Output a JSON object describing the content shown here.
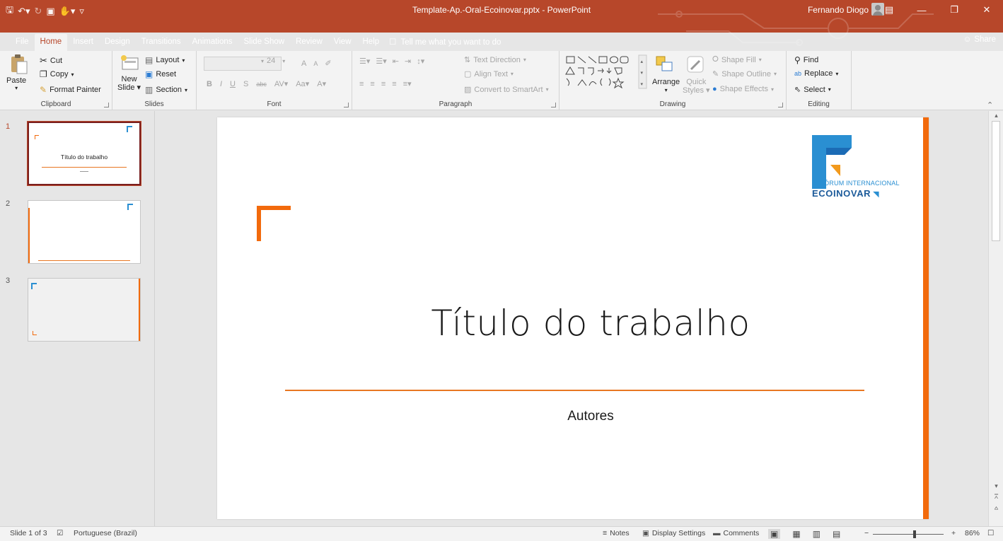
{
  "titlebar": {
    "doc_title": "Template-Ap.-Oral-Ecoinovar.pptx  -  PowerPoint",
    "user": "Fernando Diogo"
  },
  "tabs": {
    "file": "File",
    "home": "Home",
    "insert": "Insert",
    "design": "Design",
    "transitions": "Transitions",
    "animations": "Animations",
    "slideshow": "Slide Show",
    "review": "Review",
    "view": "View",
    "help": "Help",
    "tell": "Tell me what you want to do",
    "share": "Share"
  },
  "ribbon": {
    "clipboard": {
      "paste": "Paste",
      "cut": "Cut",
      "copy": "Copy",
      "format_painter": "Format Painter",
      "label": "Clipboard"
    },
    "slides": {
      "new_slide_1": "New",
      "new_slide_2": "Slide",
      "layout": "Layout",
      "reset": "Reset",
      "section": "Section",
      "label": "Slides"
    },
    "font": {
      "size": "24",
      "bold": "B",
      "italic": "I",
      "underline": "U",
      "shadow": "S",
      "strike": "abc",
      "spacing": "AV",
      "case": "Aa",
      "color": "A",
      "grow": "A",
      "shrink": "A",
      "label": "Font"
    },
    "paragraph": {
      "text_direction": "Text Direction",
      "align_text": "Align Text",
      "convert_smartart": "Convert to SmartArt",
      "label": "Paragraph"
    },
    "drawing": {
      "arrange": "Arrange",
      "quick_styles_1": "Quick",
      "quick_styles_2": "Styles",
      "shape_fill": "Shape Fill",
      "shape_outline": "Shape Outline",
      "shape_effects": "Shape Effects",
      "label": "Drawing"
    },
    "editing": {
      "find": "Find",
      "replace": "Replace",
      "select": "Select",
      "label": "Editing"
    }
  },
  "slides_pane": {
    "items": [
      {
        "number": "1",
        "title": "Título do trabalho"
      },
      {
        "number": "2"
      },
      {
        "number": "3"
      }
    ]
  },
  "slide": {
    "title": "Título do trabalho",
    "subtitle": "Autores",
    "logo_line1": "9º FÓRUM INTERNACIONAL",
    "logo_line2": "ECOINOVAR"
  },
  "statusbar": {
    "slide_info": "Slide 1 of 3",
    "language": "Portuguese (Brazil)",
    "notes": "Notes",
    "display_settings": "Display Settings",
    "comments": "Comments",
    "zoom": "86%"
  },
  "colors": {
    "accent": "#b7472a",
    "slide_orange": "#f26a0c",
    "logo_blue": "#2a8fd2",
    "logo_dark_blue": "#1b5a9a"
  }
}
